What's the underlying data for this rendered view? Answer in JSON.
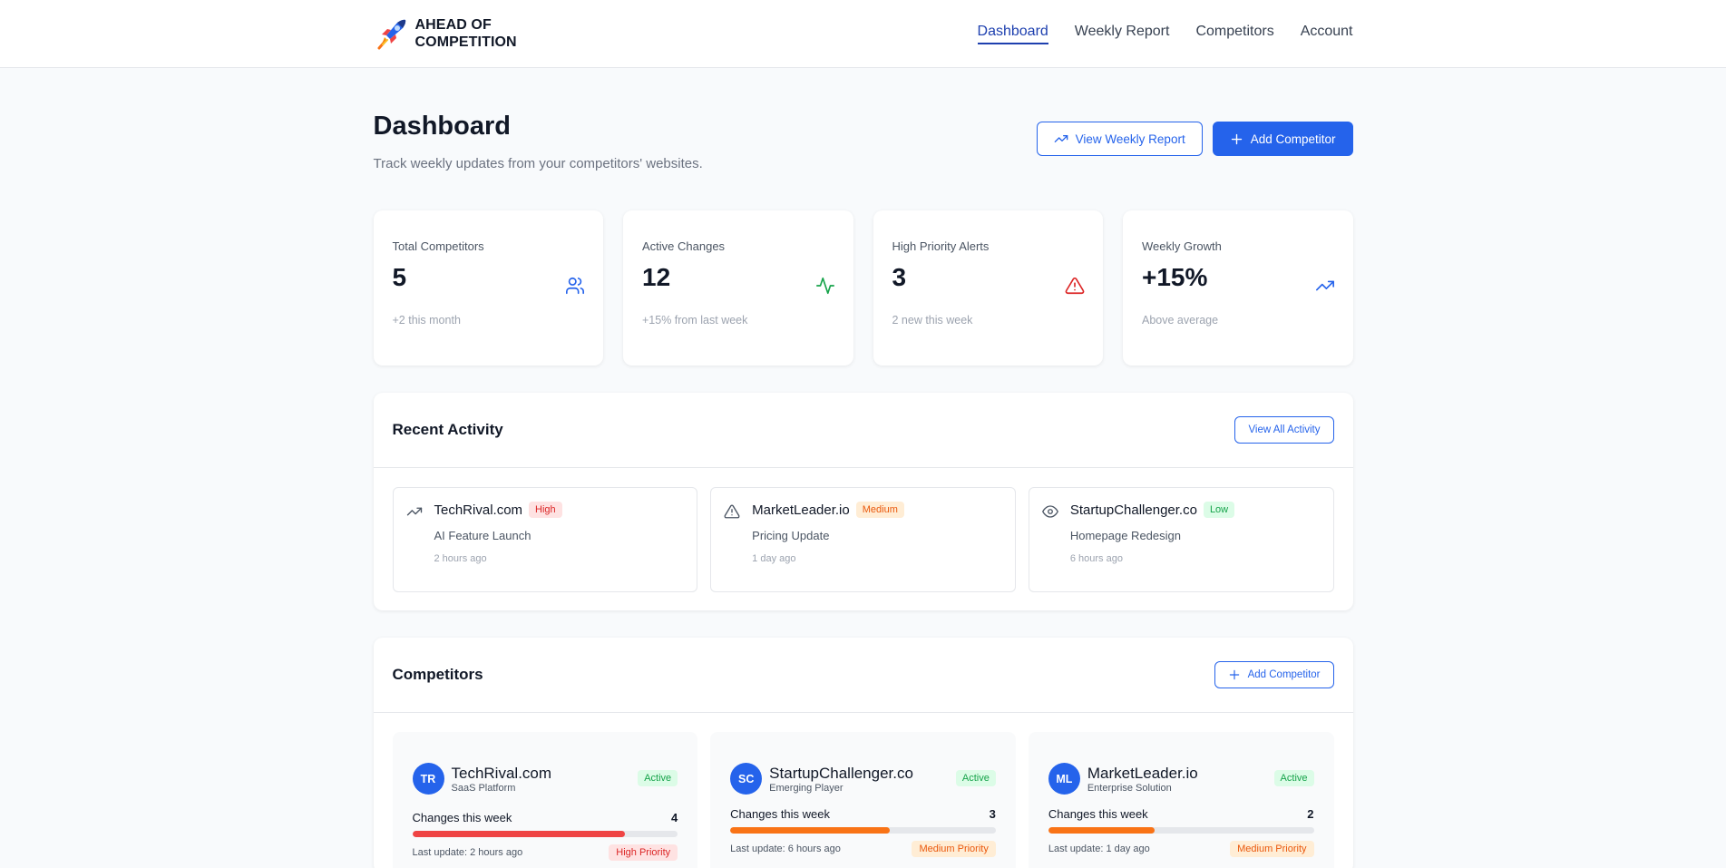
{
  "brand": {
    "line1": "AHEAD OF",
    "line2": "COMPETITION"
  },
  "nav": [
    {
      "label": "Dashboard",
      "active": true
    },
    {
      "label": "Weekly Report",
      "active": false
    },
    {
      "label": "Competitors",
      "active": false
    },
    {
      "label": "Account",
      "active": false
    }
  ],
  "header": {
    "title": "Dashboard",
    "subtitle": "Track weekly updates from your competitors' websites.",
    "view_report_label": "View Weekly Report",
    "add_competitor_label": "Add Competitor"
  },
  "stats": [
    {
      "label": "Total Competitors",
      "value": "5",
      "note": "+2 this month",
      "icon": "users-icon",
      "color": "#2563eb"
    },
    {
      "label": "Active Changes",
      "value": "12",
      "note": "+15% from last week",
      "icon": "activity-icon",
      "color": "#16a34a"
    },
    {
      "label": "High Priority Alerts",
      "value": "3",
      "note": "2 new this week",
      "icon": "alert-triangle-icon",
      "color": "#dc2626"
    },
    {
      "label": "Weekly Growth",
      "value": "+15%",
      "note": "Above average",
      "icon": "trending-up-icon",
      "color": "#2563eb"
    }
  ],
  "recent_activity": {
    "title": "Recent Activity",
    "view_all_label": "View All Activity",
    "items": [
      {
        "site": "TechRival.com",
        "priority": "High",
        "change": "AI Feature Launch",
        "time": "2 hours ago",
        "icon": "trending-up-icon"
      },
      {
        "site": "MarketLeader.io",
        "priority": "Medium",
        "change": "Pricing Update",
        "time": "1 day ago",
        "icon": "alert-triangle-icon"
      },
      {
        "site": "StartupChallenger.co",
        "priority": "Low",
        "change": "Homepage Redesign",
        "time": "6 hours ago",
        "icon": "eye-icon"
      }
    ]
  },
  "competitors": {
    "title": "Competitors",
    "add_label": "Add Competitor",
    "changes_label": "Changes this week",
    "items": [
      {
        "initials": "TR",
        "name": "TechRival.com",
        "type": "SaaS Platform",
        "status": "Active",
        "changes": "4",
        "progress": 0.8,
        "bar_color": "#ef4444",
        "update": "Last update: 2 hours ago",
        "priority": "High Priority",
        "prio_bg": "#fee2e2",
        "prio_fg": "#dc2626"
      },
      {
        "initials": "SC",
        "name": "StartupChallenger.co",
        "type": "Emerging Player",
        "status": "Active",
        "changes": "3",
        "progress": 0.6,
        "bar_color": "#f97316",
        "update": "Last update: 6 hours ago",
        "priority": "Medium Priority",
        "prio_bg": "#ffedd5",
        "prio_fg": "#ea580c"
      },
      {
        "initials": "ML",
        "name": "MarketLeader.io",
        "type": "Enterprise Solution",
        "status": "Active",
        "changes": "2",
        "progress": 0.4,
        "bar_color": "#f97316",
        "update": "Last update: 1 day ago",
        "priority": "Medium Priority",
        "prio_bg": "#ffedd5",
        "prio_fg": "#ea580c"
      }
    ]
  }
}
